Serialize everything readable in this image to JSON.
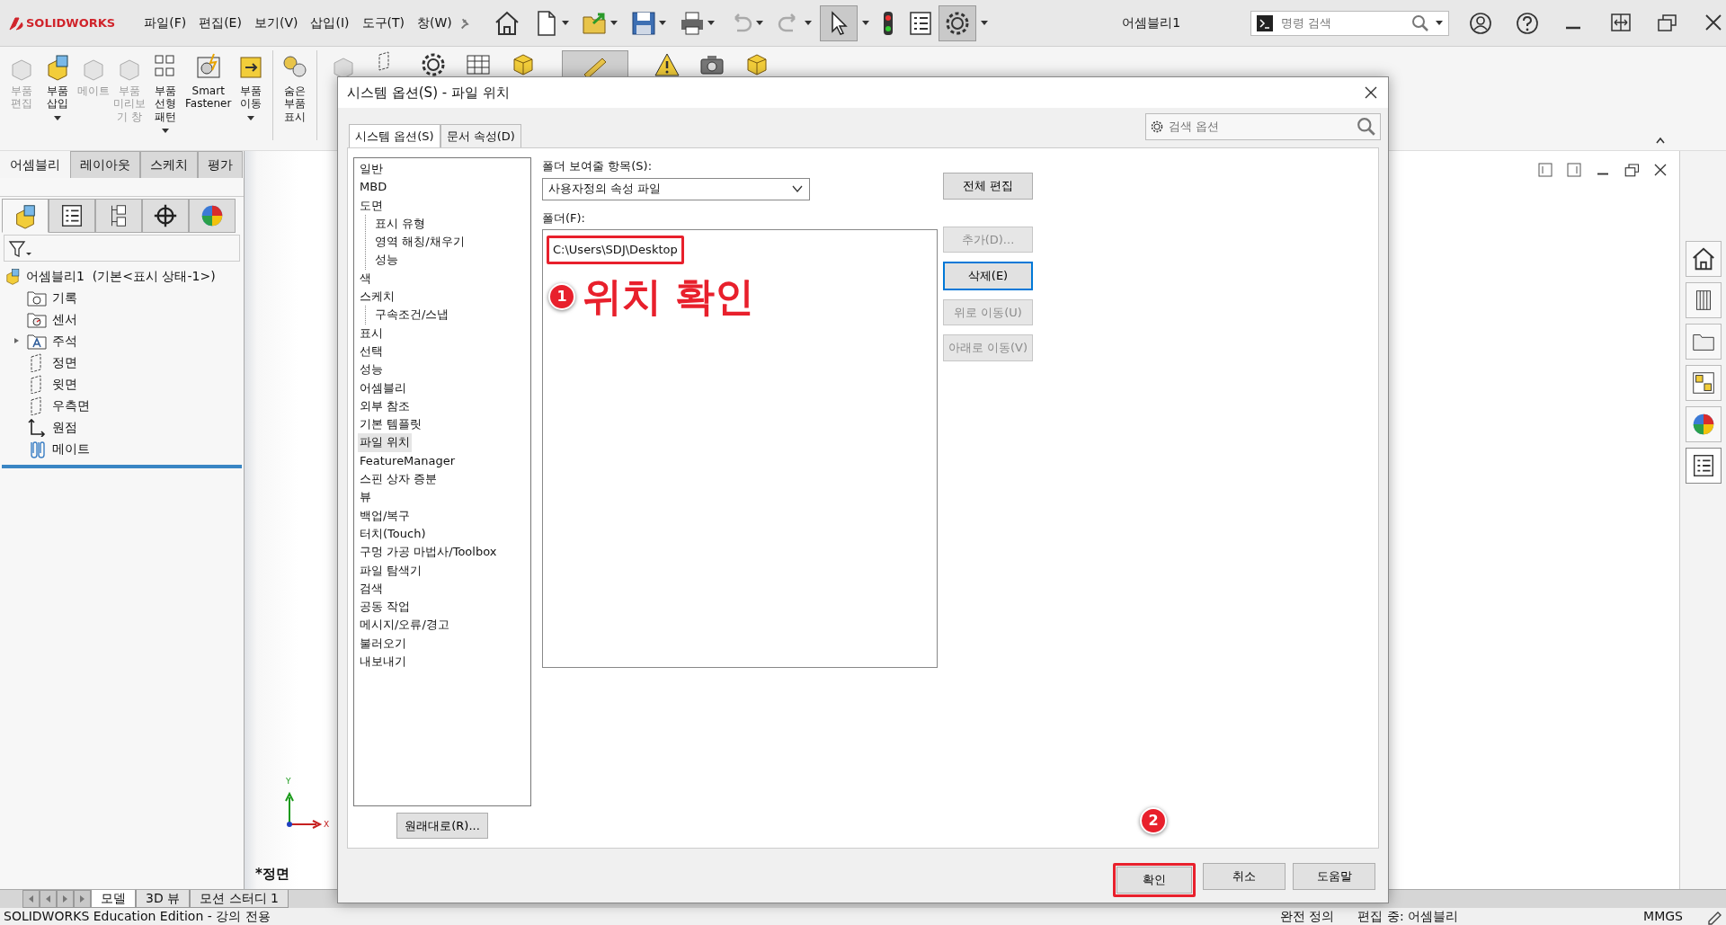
{
  "app_bar": {
    "logo": "SOLIDWORKS",
    "menus": [
      "파일(F)",
      "편집(E)",
      "보기(V)",
      "삽입(I)",
      "도구(T)",
      "창(W)"
    ],
    "title": "어셈블리1",
    "search": {
      "placeholder": "명령 검색"
    }
  },
  "ribbon": [
    {
      "label": "부품\n편집",
      "disabled": true,
      "dropdown": false
    },
    {
      "label": "부품\n삽입",
      "disabled": false,
      "dropdown": true
    },
    {
      "label": "메이트",
      "disabled": true,
      "dropdown": false
    },
    {
      "label": "부품\n미리보\n기 창",
      "disabled": true,
      "dropdown": false
    },
    {
      "label": "부품\n선형\n패턴",
      "disabled": false,
      "dropdown": true
    },
    {
      "label": "Smart\nFastener",
      "disabled": false,
      "dropdown": false
    },
    {
      "label": "부품\n이동",
      "disabled": false,
      "dropdown": true
    },
    {
      "label": "숨은\n부품\n표시",
      "disabled": false,
      "dropdown": false
    }
  ],
  "command_tabs": [
    {
      "label": "어셈블리",
      "selected": true
    },
    {
      "label": "레이아웃",
      "selected": false
    },
    {
      "label": "스케치",
      "selected": false
    },
    {
      "label": "평가",
      "selected": false
    }
  ],
  "panel_tabs": [
    {
      "selected": true
    },
    {
      "selected": false
    },
    {
      "selected": false
    },
    {
      "selected": false
    },
    {
      "selected": false
    }
  ],
  "feature_tree": {
    "root": "어셈블리1  (기본<표시 상태-1>)",
    "items": [
      {
        "label": "기록",
        "collapsed": false
      },
      {
        "label": "센서",
        "collapsed": false
      },
      {
        "label": "주석",
        "collapsed": true
      },
      {
        "label": "정면",
        "collapsed": false
      },
      {
        "label": "윗면",
        "collapsed": false
      },
      {
        "label": "우측면",
        "collapsed": false
      },
      {
        "label": "원점",
        "collapsed": false
      },
      {
        "label": "메이트",
        "collapsed": false
      }
    ]
  },
  "viewport": {
    "view_label": "*정면",
    "triad": {
      "x": "X",
      "y": "Y"
    }
  },
  "dialog": {
    "title": "시스템 옵션(S) - 파일 위치",
    "search": {
      "placeholder": "검색 옵션"
    },
    "tabs": [
      {
        "label": "시스템 옵션(S)",
        "selected": true
      },
      {
        "label": "문서 속성(D)",
        "selected": false
      }
    ],
    "options_tree": [
      {
        "label": "일반",
        "selected": false
      },
      {
        "label": "MBD",
        "selected": false
      },
      {
        "label": "도면",
        "selected": false,
        "children": [
          {
            "label": "표시 유형",
            "selected": false
          },
          {
            "label": "영역 해칭/채우기",
            "selected": false
          },
          {
            "label": "성능",
            "selected": false
          }
        ]
      },
      {
        "label": "색",
        "selected": false
      },
      {
        "label": "스케치",
        "selected": false,
        "children": [
          {
            "label": "구속조건/스냅",
            "selected": false
          }
        ]
      },
      {
        "label": "표시",
        "selected": false
      },
      {
        "label": "선택",
        "selected": false
      },
      {
        "label": "성능",
        "selected": false
      },
      {
        "label": "어셈블리",
        "selected": false
      },
      {
        "label": "외부 참조",
        "selected": false
      },
      {
        "label": "기본 템플릿",
        "selected": false
      },
      {
        "label": "파일 위치",
        "selected": true
      },
      {
        "label": "FeatureManager",
        "selected": false
      },
      {
        "label": "스핀 상자 증분",
        "selected": false
      },
      {
        "label": "뷰",
        "selected": false
      },
      {
        "label": "백업/복구",
        "selected": false
      },
      {
        "label": "터치(Touch)",
        "selected": false
      },
      {
        "label": "구멍 가공 마법사/Toolbox",
        "selected": false
      },
      {
        "label": "파일 탐색기",
        "selected": false
      },
      {
        "label": "검색",
        "selected": false
      },
      {
        "label": "공동 작업",
        "selected": false
      },
      {
        "label": "메시지/오류/경고",
        "selected": false
      },
      {
        "label": "불러오기",
        "selected": false
      },
      {
        "label": "내보내기",
        "selected": false
      }
    ],
    "show_folders_label": "폴더 보여줄 항목(S):",
    "show_folders_value": "사용자정의 속성 파일",
    "folders_label": "폴더(F):",
    "folders": [
      {
        "path": "C:\\Users\\SDJ\\Desktop",
        "annotation": {
          "number": "1",
          "text": "위치 확인"
        }
      }
    ],
    "side_buttons": [
      {
        "label": "전체 편집",
        "disabled": false,
        "focused": false
      },
      {
        "label": "추가(D)...",
        "disabled": true,
        "focused": false
      },
      {
        "label": "삭제(E)",
        "disabled": false,
        "focused": true
      },
      {
        "label": "위로 이동(U)",
        "disabled": true,
        "focused": false
      },
      {
        "label": "아래로 이동(V)",
        "disabled": true,
        "focused": false
      }
    ],
    "reset_button": "원래대로(R)...",
    "footer_buttons": [
      {
        "label": "확인",
        "annotation": {
          "number": "2"
        }
      },
      {
        "label": "취소"
      },
      {
        "label": "도움말"
      }
    ]
  },
  "bottom_tabs": [
    {
      "label": "모델",
      "selected": true
    },
    {
      "label": "3D 뷰",
      "selected": false
    },
    {
      "label": "모션 스터디 1",
      "selected": false
    }
  ],
  "status_bar": {
    "left": "SOLIDWORKS Education Edition - 강의 전용",
    "right": [
      "완전 정의",
      "편집 중: 어셈블리",
      "MMGS"
    ]
  }
}
